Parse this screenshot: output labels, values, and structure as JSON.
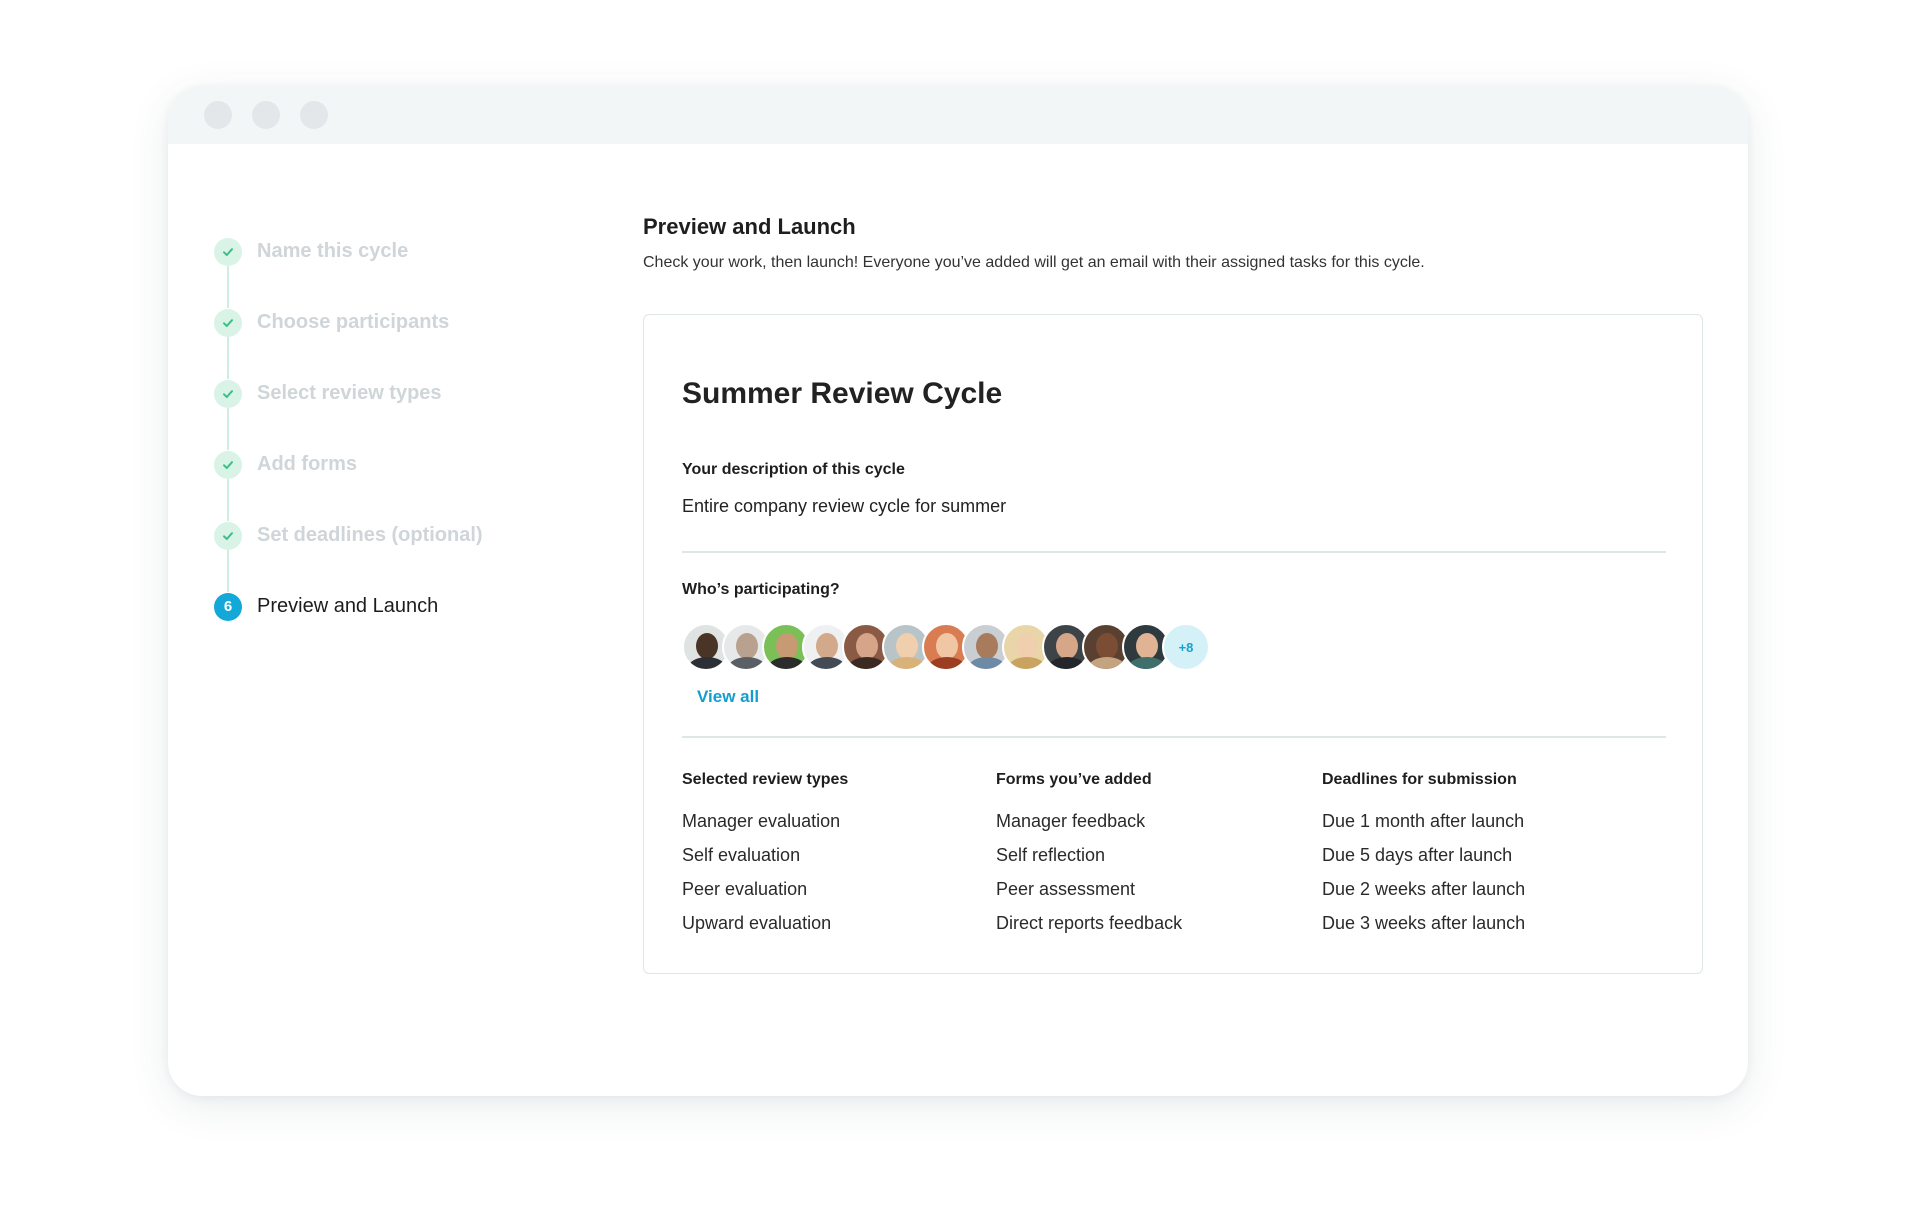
{
  "stepper": {
    "steps": [
      {
        "label": "Name this cycle",
        "status": "done"
      },
      {
        "label": "Choose participants",
        "status": "done"
      },
      {
        "label": "Select review types",
        "status": "done"
      },
      {
        "label": "Add forms",
        "status": "done"
      },
      {
        "label": "Set deadlines (optional)",
        "status": "done"
      },
      {
        "label": "Preview and Launch",
        "status": "current",
        "number": "6"
      }
    ]
  },
  "header": {
    "title": "Preview and Launch",
    "subtitle": "Check your work, then launch! Everyone you’ve added will get an email with their assigned tasks for this cycle."
  },
  "card": {
    "title": "Summer Review Cycle",
    "description_label": "Your description of this cycle",
    "description_value": "Entire company review cycle for summer",
    "participants_label": "Who’s participating?",
    "participants_more": "+8",
    "view_all": "View all",
    "columns": [
      {
        "heading": "Selected review types",
        "items": [
          "Manager evaluation",
          "Self evaluation",
          "Peer evaluation",
          "Upward evaluation"
        ]
      },
      {
        "heading": "Forms you’ve added",
        "items": [
          "Manager feedback",
          "Self reflection",
          "Peer assessment",
          "Direct reports feedback"
        ]
      },
      {
        "heading": "Deadlines for submission",
        "items": [
          "Due 1 month after launch",
          "Due 5 days after launch",
          "Due 2 weeks after launch",
          "Due 3 weeks after launch"
        ]
      }
    ]
  },
  "colors": {
    "accent": "#14a8d8",
    "done_check_bg": "#d9f3e7",
    "done_check": "#3cbf86",
    "muted_label": "#cfd5d8"
  }
}
